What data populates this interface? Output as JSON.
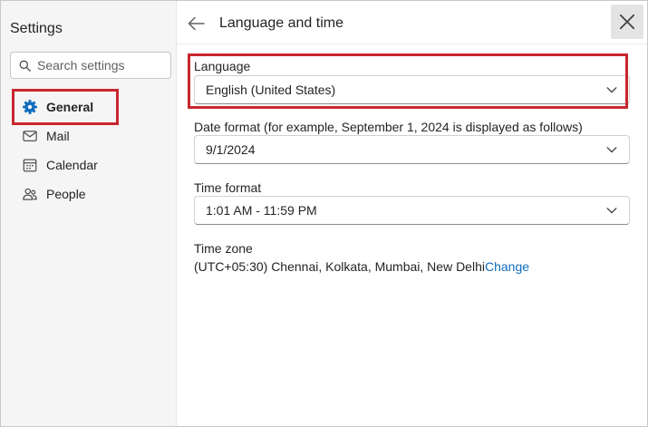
{
  "sidebar": {
    "title": "Settings",
    "search_placeholder": "Search settings",
    "items": [
      {
        "label": "General",
        "icon": "gear-icon",
        "active": true
      },
      {
        "label": "Mail",
        "icon": "mail-icon"
      },
      {
        "label": "Calendar",
        "icon": "calendar-icon"
      },
      {
        "label": "People",
        "icon": "people-icon"
      }
    ]
  },
  "header": {
    "title": "Language and time",
    "back_icon": "arrow-left-icon",
    "close_icon": "close-icon"
  },
  "language": {
    "label": "Language",
    "value": "English (United States)"
  },
  "date_format": {
    "label": "Date format (for example, September 1, 2024 is displayed as follows)",
    "value": "9/1/2024"
  },
  "time_format": {
    "label": "Time format",
    "value": "1:01 AM - 11:59 PM"
  },
  "time_zone": {
    "label": "Time zone",
    "value": "(UTC+05:30) Chennai, Kolkata, Mumbai, New Delhi",
    "change_label": "Change"
  },
  "colors": {
    "accent": "#0f6cbd",
    "highlight": "#c8262f",
    "sidebar_bg": "#f5f5f5"
  }
}
